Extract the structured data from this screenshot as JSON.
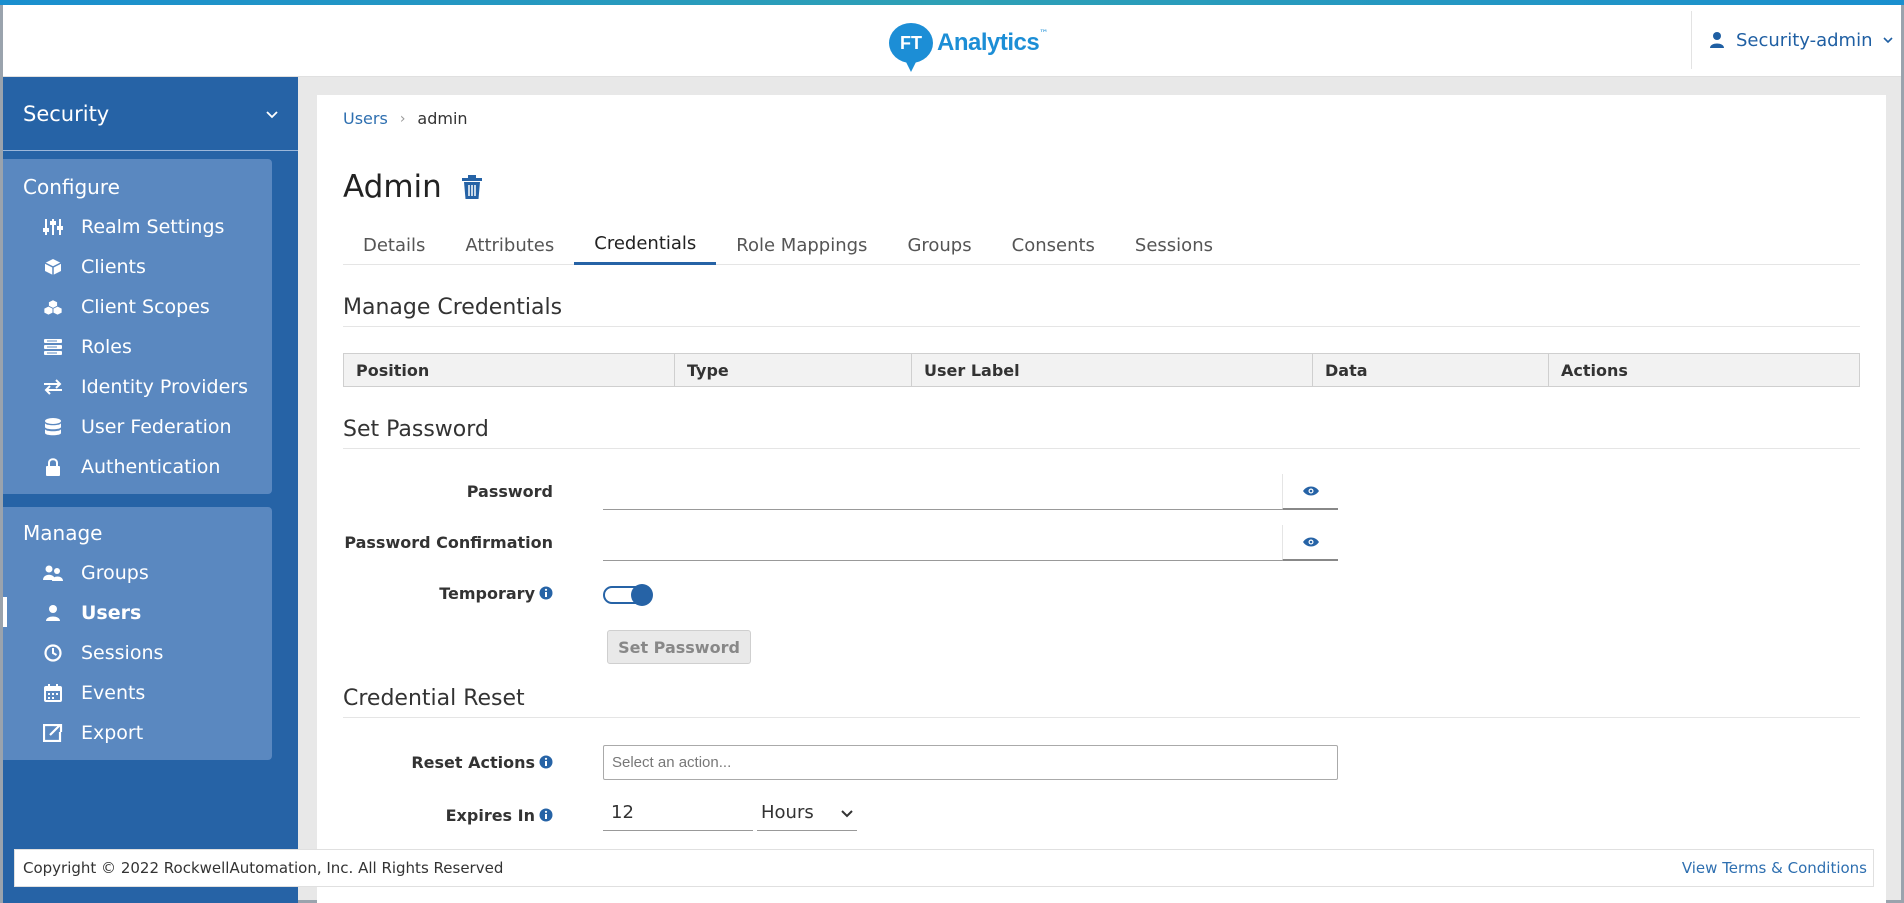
{
  "header": {
    "logo_mark": "FT",
    "logo_text": "Analytics",
    "logo_tm": "™",
    "user_name": "Security-admin"
  },
  "sidebar": {
    "realm": "Security",
    "configure": {
      "title": "Configure",
      "items": [
        {
          "label": "Realm Settings",
          "icon": "sliders-icon"
        },
        {
          "label": "Clients",
          "icon": "cube-icon"
        },
        {
          "label": "Client Scopes",
          "icon": "cubes-icon"
        },
        {
          "label": "Roles",
          "icon": "list-icon"
        },
        {
          "label": "Identity Providers",
          "icon": "exchange-icon"
        },
        {
          "label": "User Federation",
          "icon": "database-icon"
        },
        {
          "label": "Authentication",
          "icon": "lock-icon"
        }
      ]
    },
    "manage": {
      "title": "Manage",
      "items": [
        {
          "label": "Groups",
          "icon": "users-icon"
        },
        {
          "label": "Users",
          "icon": "user-icon",
          "active": true
        },
        {
          "label": "Sessions",
          "icon": "clock-icon"
        },
        {
          "label": "Events",
          "icon": "calendar-icon"
        },
        {
          "label": "Export",
          "icon": "export-icon"
        }
      ]
    }
  },
  "breadcrumb": {
    "link": "Users",
    "current": "admin"
  },
  "page": {
    "title": "Admin"
  },
  "tabs": [
    "Details",
    "Attributes",
    "Credentials",
    "Role Mappings",
    "Groups",
    "Consents",
    "Sessions"
  ],
  "active_tab": "Credentials",
  "manage_credentials": {
    "title": "Manage Credentials",
    "columns": [
      "Position",
      "Type",
      "User Label",
      "Data",
      "Actions"
    ]
  },
  "set_password": {
    "title": "Set Password",
    "password_label": "Password",
    "password_value": "",
    "confirmation_label": "Password Confirmation",
    "confirmation_value": "",
    "temporary_label": "Temporary",
    "temporary_on": true,
    "button": "Set Password"
  },
  "credential_reset": {
    "title": "Credential Reset",
    "reset_actions_label": "Reset Actions",
    "reset_actions_placeholder": "Select an action...",
    "expires_label": "Expires In",
    "expires_value": "12",
    "expires_unit": "Hours"
  },
  "footer": {
    "copyright": "Copyright © 2022 RockwellAutomation, Inc. All Rights Reserved",
    "terms": "View Terms & Conditions"
  },
  "colors": {
    "primary": "#2663a6",
    "nav_group": "#5a88c0",
    "brand": "#1c8ed6",
    "link": "#2e6fb0"
  }
}
